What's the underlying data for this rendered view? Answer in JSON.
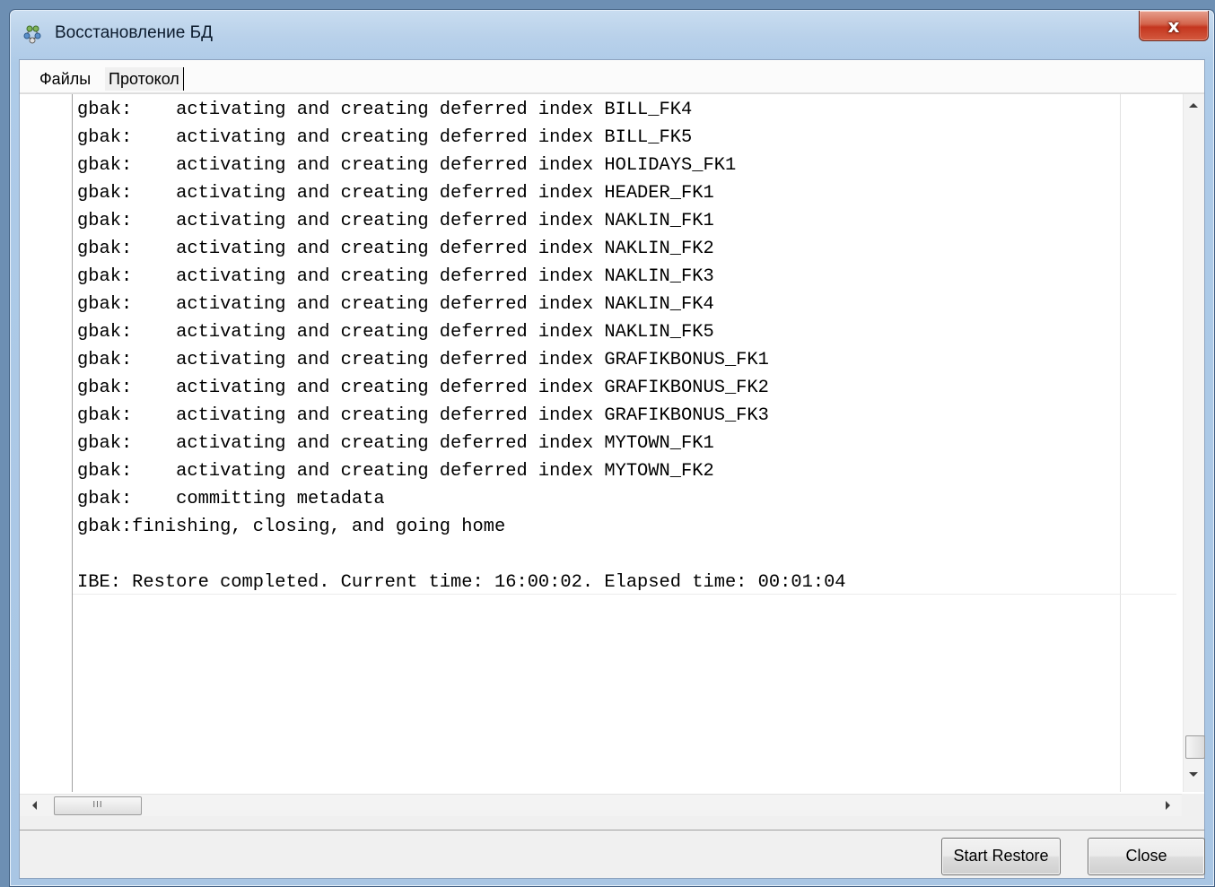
{
  "window": {
    "title": "Восстановление БД",
    "close_glyph": "x",
    "icon": "database-network-icon"
  },
  "tabs": [
    {
      "label": "Файлы"
    },
    {
      "label": "Протокол",
      "active": true
    }
  ],
  "log": {
    "text": "gbak:    activating and creating deferred index BILL_FK4\ngbak:    activating and creating deferred index BILL_FK5\ngbak:    activating and creating deferred index HOLIDAYS_FK1\ngbak:    activating and creating deferred index HEADER_FK1\ngbak:    activating and creating deferred index NAKLIN_FK1\ngbak:    activating and creating deferred index NAKLIN_FK2\ngbak:    activating and creating deferred index NAKLIN_FK3\ngbak:    activating and creating deferred index NAKLIN_FK4\ngbak:    activating and creating deferred index NAKLIN_FK5\ngbak:    activating and creating deferred index GRAFIKBONUS_FK1\ngbak:    activating and creating deferred index GRAFIKBONUS_FK2\ngbak:    activating and creating deferred index GRAFIKBONUS_FK3\ngbak:    activating and creating deferred index MYTOWN_FK1\ngbak:    activating and creating deferred index MYTOWN_FK2\ngbak:    committing metadata\ngbak:finishing, closing, and going home\n\nIBE: Restore completed. Current time: 16:00:02. Elapsed time: 00:01:04"
  },
  "scrollbar": {
    "h_thumb_grip": "III"
  },
  "buttons": {
    "start_restore": "Start Restore",
    "close": "Close"
  }
}
